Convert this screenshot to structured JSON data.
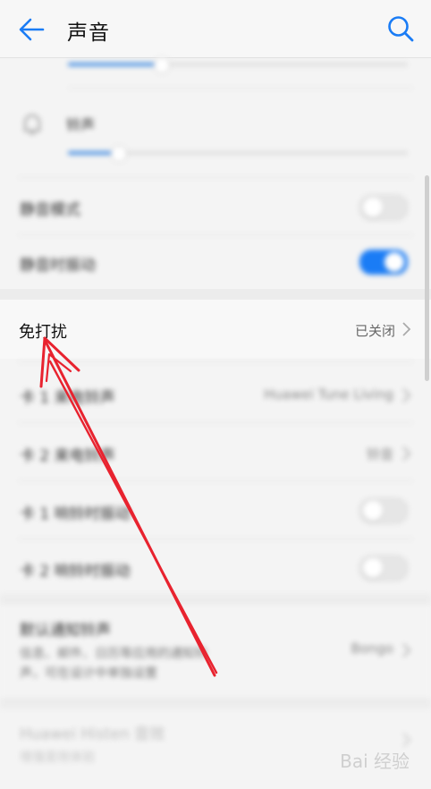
{
  "header": {
    "title": "声音",
    "back_icon": "arrow-left-icon",
    "search_icon": "search-icon"
  },
  "settings": {
    "ringtone_label": "铃声",
    "silent_mode_label": "静音模式",
    "vibrate_silent_label": "静音时振动",
    "dnd": {
      "label": "免打扰",
      "value": "已关闭"
    },
    "sim1_ringtone": {
      "label": "卡 1 来电铃声",
      "value": "Huawei Tune Living"
    },
    "sim2_ringtone": {
      "label": "卡 2 来电铃声",
      "value": "铃音"
    },
    "sim1_vibrate": {
      "label": "卡 1 响铃时振动"
    },
    "sim2_vibrate": {
      "label": "卡 2 响铃时振动"
    },
    "default_notification": {
      "label": "默认通知铃声",
      "description_line1": "信息、邮件、日历等应用的通知铃",
      "description_line2": "声，可在设计中单独设置",
      "value": "Bongo"
    },
    "histen": {
      "label": "Huawei Histen 音效",
      "description": "增强音效体验"
    }
  },
  "colors": {
    "accent": "#1a7cf5",
    "annotation_arrow": "#e8232f"
  },
  "watermark": "Bai 经验"
}
